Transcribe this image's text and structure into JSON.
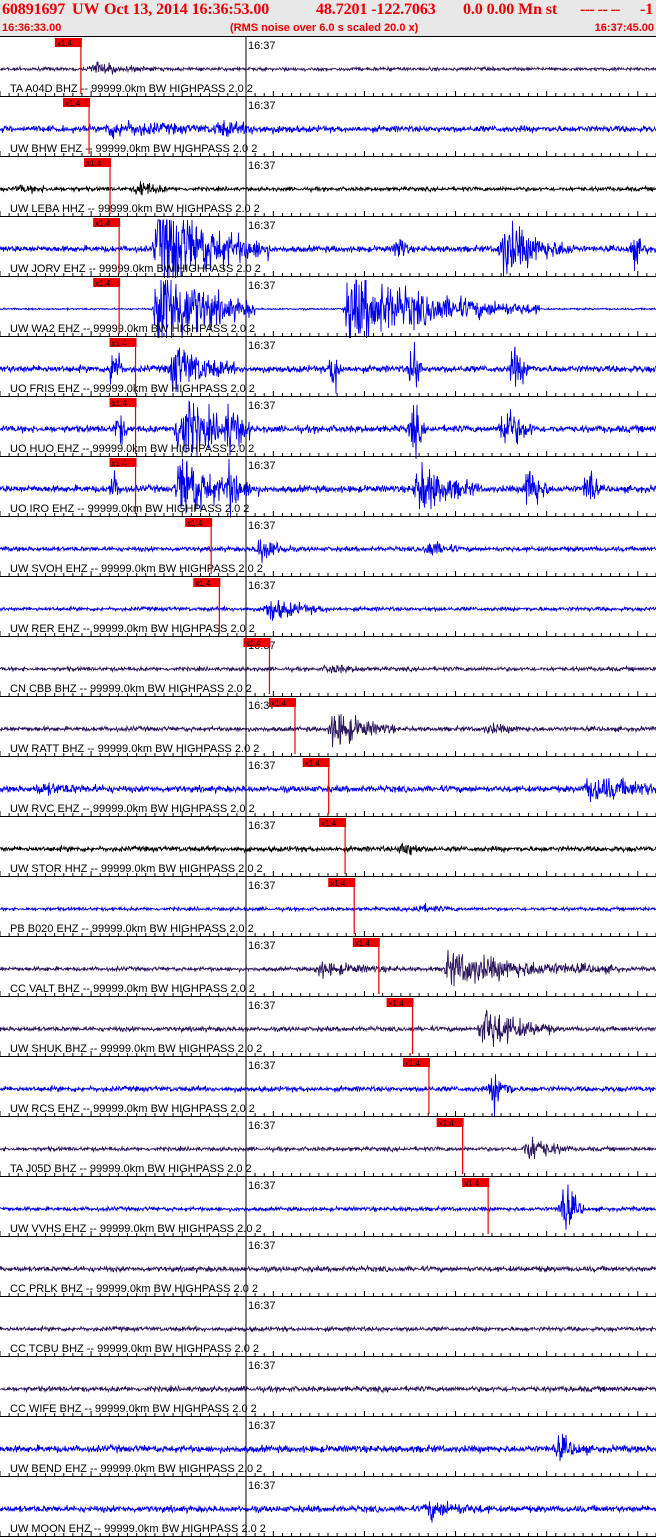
{
  "header": {
    "event_id": "60891697",
    "network": "UW",
    "date_time": "Oct 13, 2014 16:36:53.00",
    "lat_lon": "48.7201 -122.7063",
    "depth_mag": "0.0 0.00 Mn st",
    "trailing": "--- -- --",
    "tail_number": "-1"
  },
  "subheader": {
    "start_time": "16:36:33.00",
    "note": "(RMS noise over 6.0 s scaled 20.0 x)",
    "end_time": "16:37:45.00"
  },
  "colors": {
    "header_text": "#ee0000",
    "header_bg": "#e8e8e8",
    "trace_blue": "#0000ee",
    "trace_purple": "#2a1760",
    "trace_black": "#000000",
    "pick_box": "#ee0000",
    "pick_line": "#ee0000"
  },
  "chart_data": {
    "type": "line",
    "title": "",
    "time_axis": {
      "start": "16:36:33.00",
      "end": "16:37:45.00",
      "minute_tick_label": "16:37"
    },
    "pick_label": "x1.4",
    "channels": [
      {
        "label": "TA A04D BHZ -- 99999.0km BW HIGHPASS 2.0 2",
        "color": "purple",
        "pick_time": "16:36:39.9"
      },
      {
        "label": "UW BHW EHZ -- 99999.0km BW HIGHPASS 2.0 2",
        "color": "blue",
        "pick_time": "16:36:40.8"
      },
      {
        "label": "UW LEBA HHZ -- 99999.0km BW HIGHPASS 2.0 2",
        "color": "black",
        "pick_time": "16:36:43.1"
      },
      {
        "label": "UW JORV EHZ -- 99999.0km BW HIGHPASS 2.0 2",
        "color": "blue",
        "pick_time": "16:36:44.1"
      },
      {
        "label": "UW WA2 EHZ -- 99999.0km BW HIGHPASS 2.0 2",
        "color": "blue",
        "pick_time": "16:36:44.1"
      },
      {
        "label": "UO FRIS EHZ -- 99999.0km BW HIGHPASS 2.0 2",
        "color": "blue",
        "pick_time": "16:36:45.9"
      },
      {
        "label": "UO HUO EHZ -- 99999.0km BW HIGHPASS 2.0 2",
        "color": "blue",
        "pick_time": "16:36:45.9"
      },
      {
        "label": "UO IRO EHZ -- 99999.0km BW HIGHPASS 2.0 2",
        "color": "blue",
        "pick_time": "16:36:45.9"
      },
      {
        "label": "UW SVOH EHZ -- 99999.0km BW HIGHPASS 2.0 2",
        "color": "blue",
        "pick_time": "16:36:54.2"
      },
      {
        "label": "UW RER EHZ -- 99999.0km BW HIGHPASS 2.0 2",
        "color": "blue",
        "pick_time": "16:36:55.1"
      },
      {
        "label": "CN CBB BHZ -- 99999.0km BW HIGHPASS 2.0 2",
        "color": "purple",
        "pick_time": "16:37:00.6"
      },
      {
        "label": "UW RATT BHZ -- 99999.0km BW HIGHPASS 2.0 2",
        "color": "purple",
        "pick_time": "16:37:03.4"
      },
      {
        "label": "UW RVC EHZ -- 99999.0km BW HIGHPASS 2.0 2",
        "color": "blue",
        "pick_time": "16:37:07.1"
      },
      {
        "label": "UW STOR HHZ -- 99999.0km BW HIGHPASS 2.0 2",
        "color": "black",
        "pick_time": "16:37:08.9"
      },
      {
        "label": "PB B020 EHZ -- 99999.0km BW HIGHPASS 2.0 2",
        "color": "blue",
        "pick_time": "16:37:09.9"
      },
      {
        "label": "CC VALT BHZ -- 99999.0km BW HIGHPASS 2.0 2",
        "color": "purple",
        "pick_time": "16:37:12.6"
      },
      {
        "label": "UW SHUK BHZ -- 99999.0km BW HIGHPASS 2.0 2",
        "color": "purple",
        "pick_time": "16:37:16.3"
      },
      {
        "label": "UW RCS EHZ -- 99999.0km BW HIGHPASS 2.0 2",
        "color": "blue",
        "pick_time": "16:37:18.1"
      },
      {
        "label": "TA J05D BHZ -- 99999.0km BW HIGHPASS 2.0 2",
        "color": "purple",
        "pick_time": "16:37:21.8"
      },
      {
        "label": "UW VVHS EHZ -- 99999.0km BW HIGHPASS 2.0 2",
        "color": "blue",
        "pick_time": "16:37:24.6"
      },
      {
        "label": "CC PRLK BHZ -- 99999.0km BW HIGHPASS 2.0 2",
        "color": "purple"
      },
      {
        "label": "CC TCBU BHZ -- 99999.0km BW HIGHPASS 2.0 2",
        "color": "purple"
      },
      {
        "label": "CC WIFE BHZ -- 99999.0km BW HIGHPASS 2.0 2",
        "color": "purple"
      },
      {
        "label": "UW BEND EHZ -- 99999.0km BW HIGHPASS 2.0 2",
        "color": "blue"
      },
      {
        "label": "UW MOON EHZ -- 99999.0km BW HIGHPASS 2.0 2",
        "color": "blue"
      }
    ]
  }
}
